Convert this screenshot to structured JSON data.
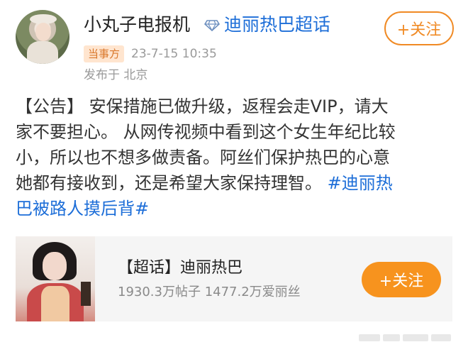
{
  "header": {
    "username": "小丸子电报机",
    "topic_link": "迪丽热巴超话",
    "follow_label": "+关注",
    "badge": "当事方",
    "timestamp": "23-7-15 10:35",
    "location": "发布于 北京",
    "icons": [
      "avatar",
      "diamond-icon"
    ]
  },
  "post": {
    "lines": [
      "【公告】 安保措施已做升级，返程会走VIP，请大",
      "家不要担心。 从网传视频中看到这个女生年纪比较",
      "小，所以也不想多做责备。阿丝们保护热巴的心意",
      "她都有接收到，还是希望大家保持理智。"
    ],
    "hashtag_start": "#迪丽热",
    "hashtag_end": "巴被路人摸后背#"
  },
  "card": {
    "title": "【超话】迪丽热巴",
    "stats": "1930.3万帖子 1477.2万爱丽丝",
    "follow_label": "+关注"
  },
  "colors": {
    "link": "#1d6ed8",
    "accent_orange": "#f08a24",
    "button_fill": "#f7931e",
    "card_bg": "#f5f5f5"
  }
}
